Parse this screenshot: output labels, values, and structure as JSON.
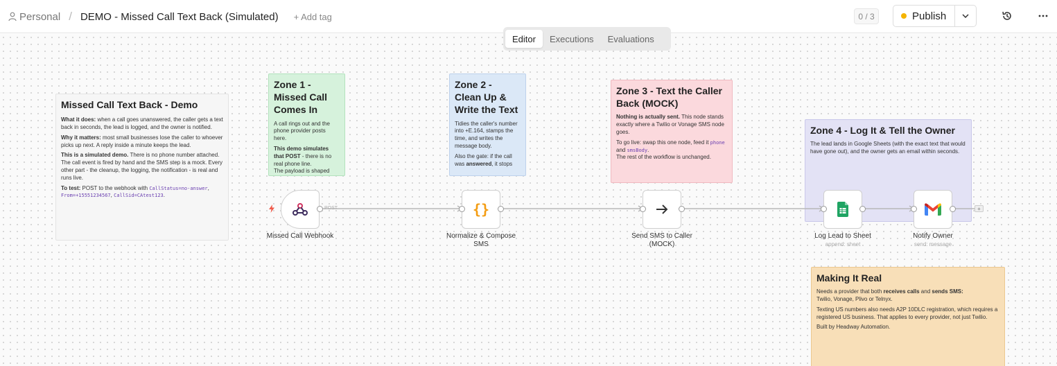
{
  "header": {
    "project": "Personal",
    "title": "DEMO - Missed Call Text Back (Simulated)",
    "add_tag": "+ Add tag",
    "counter": "0 / 3",
    "publish_label": "Publish",
    "status_color": "#f5b400"
  },
  "tabs": [
    {
      "label": "Editor",
      "active": true
    },
    {
      "label": "Executions",
      "active": false
    },
    {
      "label": "Evaluations",
      "active": false
    }
  ],
  "notes": {
    "main": {
      "title": "Missed Call Text Back - Demo",
      "p1_bold": "What it does:",
      "p1": "when a call goes unanswered, the caller gets a text back in seconds, the lead is logged, and the owner is notified.",
      "p2_bold": "Why it matters:",
      "p2": "most small businesses lose the caller to whoever picks up next. A reply inside a minute keeps the lead.",
      "p3_bold": "This is a simulated demo.",
      "p3": "There is no phone number attached. The call event is fired by hand and the SMS step is a mock. Every other part - the cleanup, the logging, the notification - is real and runs live.",
      "p4_bold": "To test:",
      "p4": "POST to the webhook with",
      "code1": "CallStatus=no-answer",
      "code2": "From=+15551234567",
      "code3": "CallSid=CAtest123"
    },
    "zone1": {
      "title": "Zone 1 - Missed Call Comes In",
      "p1": "A call rings out and the phone provider posts here.",
      "p2_bold": "This demo simulates that POST",
      "p2": "- there is no real phone line.",
      "p3": "The payload is shaped"
    },
    "zone2": {
      "title": "Zone 2 - Clean Up & Write the Text",
      "p1": "Tidies the caller's number into +E.164, stamps the time, and writes the message body.",
      "p2_pre": "Also the gate: if the call was",
      "p2_bold": "answered",
      "p2_post": ", it stops"
    },
    "zone3": {
      "title": "Zone 3 - Text the Caller Back (MOCK)",
      "p1_bold": "Nothing is actually sent.",
      "p1": "This node stands exactly where a Twilio or Vonage SMS node goes.",
      "p2": "To go live: swap this one node, feed it",
      "code1": "phone",
      "and": "and",
      "code2": "smsBody",
      "p3": "The rest of the workflow is unchanged."
    },
    "zone4": {
      "title": "Zone 4 - Log It & Tell the Owner",
      "p1": "The lead lands in Google Sheets (with the exact text that would have gone out), and the owner gets an email within seconds."
    },
    "real": {
      "title": "Making It Real",
      "p1_pre": "Needs a provider that both",
      "p1_b1": "receives calls",
      "p1_and": "and",
      "p1_b2": "sends SMS:",
      "p1_post": "Twilio, Vonage, Plivo or Telnyx.",
      "p2": "Texting US numbers also needs A2P 10DLC registration, which requires a registered US business. That applies to every provider, not just Twilio.",
      "p3": "Built by Headway Automation."
    }
  },
  "nodes": {
    "webhook": {
      "label": "Missed Call Webhook",
      "port_label": "POST",
      "icon": "webhook-icon"
    },
    "normalize": {
      "label": "Normalize & Compose SMS",
      "icon": "code-braces-icon",
      "icon_glyph": "{}"
    },
    "sms": {
      "label": "Send SMS to Caller (MOCK)",
      "icon": "arrow-right-icon"
    },
    "sheet": {
      "label": "Log Lead to Sheet",
      "sub": "append: sheet",
      "icon": "google-sheets-icon"
    },
    "gmail": {
      "label": "Notify Owner",
      "sub": "send: message",
      "icon": "gmail-icon"
    },
    "add": "+"
  }
}
